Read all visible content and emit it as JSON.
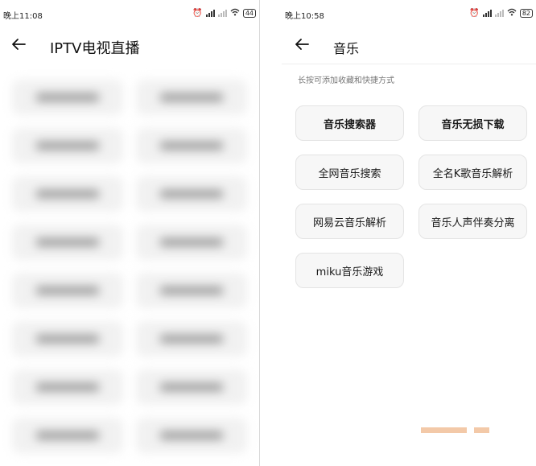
{
  "left": {
    "status": {
      "time": "晚上11:08",
      "battery": "44"
    },
    "title": "IPTV电视直播"
  },
  "right": {
    "status": {
      "time": "晚上10:58",
      "battery": "82"
    },
    "title": "音乐",
    "hint": "长按可添加收藏和快捷方式",
    "buttons": [
      {
        "label": "音乐搜索器"
      },
      {
        "label": "音乐无损下载"
      },
      {
        "label": "全网音乐搜索"
      },
      {
        "label": "全名K歌音乐解析"
      },
      {
        "label": "网易云音乐解析"
      },
      {
        "label": "音乐人声伴奏分离"
      },
      {
        "label": "miku音乐游戏"
      }
    ]
  },
  "icons": {
    "back": "back-arrow-icon",
    "alarm": "alarm-off-icon",
    "signal": "signal-icon",
    "wifi": "wifi-icon",
    "battery": "battery-icon"
  }
}
